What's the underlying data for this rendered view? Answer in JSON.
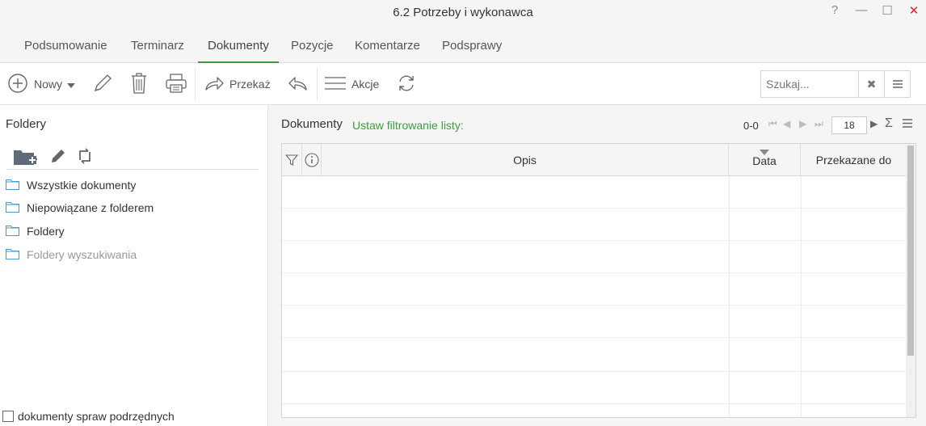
{
  "window": {
    "title": "6.2 Potrzeby i wykonawca",
    "help": "?",
    "minimize": "—",
    "maximize": "☐",
    "close": "✕"
  },
  "tabs": [
    "Podsumowanie",
    "Terminarz",
    "Dokumenty",
    "Pozycje",
    "Komentarze",
    "Podsprawy"
  ],
  "active_tab": "Dokumenty",
  "toolbar": {
    "new_label": "Nowy",
    "forward_label": "Przekaż",
    "actions_label": "Akcje",
    "search_placeholder": "Szukaj..."
  },
  "folders_panel": {
    "title": "Foldery",
    "items": [
      {
        "label": "Wszystkie dokumenty",
        "muted": false
      },
      {
        "label": "Niepowiązane z folderem",
        "muted": false
      },
      {
        "label": "Foldery",
        "muted": false
      },
      {
        "label": "Foldery wyszukiwania",
        "muted": true
      }
    ],
    "checkbox_label": "dokumenty spraw podrzędnych"
  },
  "documents": {
    "title": "Dokumenty",
    "filter_link": "Ustaw filtrowanie listy:",
    "range": "0-0",
    "page_size": "18",
    "columns": [
      "Opis",
      "Data",
      "Przekazane do"
    ],
    "rows": []
  },
  "colors": {
    "accent": "#3a9e3a",
    "close": "#d9262a",
    "folder_icon": "#4a9ac4"
  }
}
